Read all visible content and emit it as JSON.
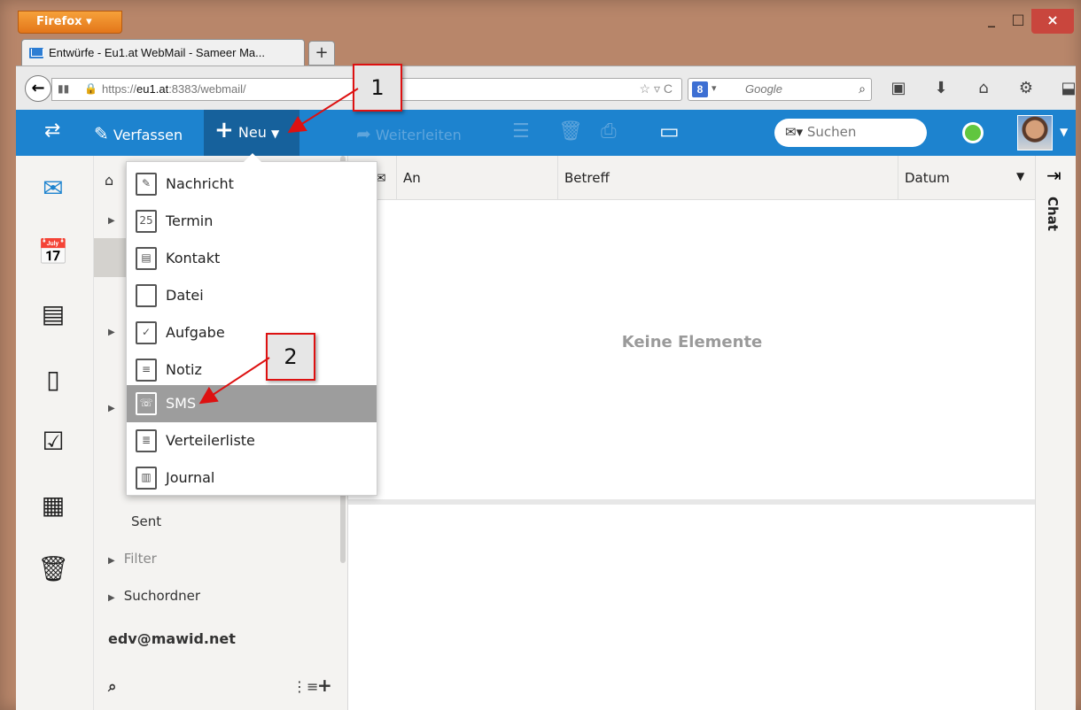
{
  "browser": {
    "button_label": "Firefox",
    "tab_title": "Entwürfe - Eu1.at WebMail - Sameer Ma...",
    "new_tab": "+",
    "url_prefix": "https://",
    "url_host": "eu1.at",
    "url_rest": ":8383/webmail/",
    "search_engine_placeholder": "Google",
    "window_buttons": [
      "_",
      "□",
      "×"
    ]
  },
  "toolbar": {
    "verfassen": "Verfassen",
    "neu": "Neu",
    "weiterleiten": "Weiterleiten",
    "search_placeholder": "Suchen"
  },
  "folders": {
    "sent": "Sent",
    "filter": "Filter",
    "suchordner": "Suchordner",
    "account": "edv@mawid.net"
  },
  "list": {
    "headers": [
      "An",
      "Betreff",
      "Datum"
    ],
    "empty_message": "Keine Elemente"
  },
  "chat": {
    "label": "Chat"
  },
  "dropdown": {
    "items": [
      {
        "label": "Nachricht",
        "icon": "compose-icon"
      },
      {
        "label": "Termin",
        "icon": "calendar-icon"
      },
      {
        "label": "Kontakt",
        "icon": "contact-card-icon"
      },
      {
        "label": "Datei",
        "icon": "file-icon"
      },
      {
        "label": "Aufgabe",
        "icon": "task-icon"
      },
      {
        "label": "Notiz",
        "icon": "note-icon"
      },
      {
        "label": "SMS",
        "icon": "sms-phone-icon"
      },
      {
        "label": "Verteilerliste",
        "icon": "distribution-list-icon"
      },
      {
        "label": "Journal",
        "icon": "journal-book-icon"
      }
    ],
    "selected": "SMS"
  },
  "callouts": [
    "1",
    "2"
  ],
  "colors": {
    "toolbar": "#1d83cf",
    "accent_red": "#dd1111",
    "selected_item": "#9d9d9d"
  }
}
